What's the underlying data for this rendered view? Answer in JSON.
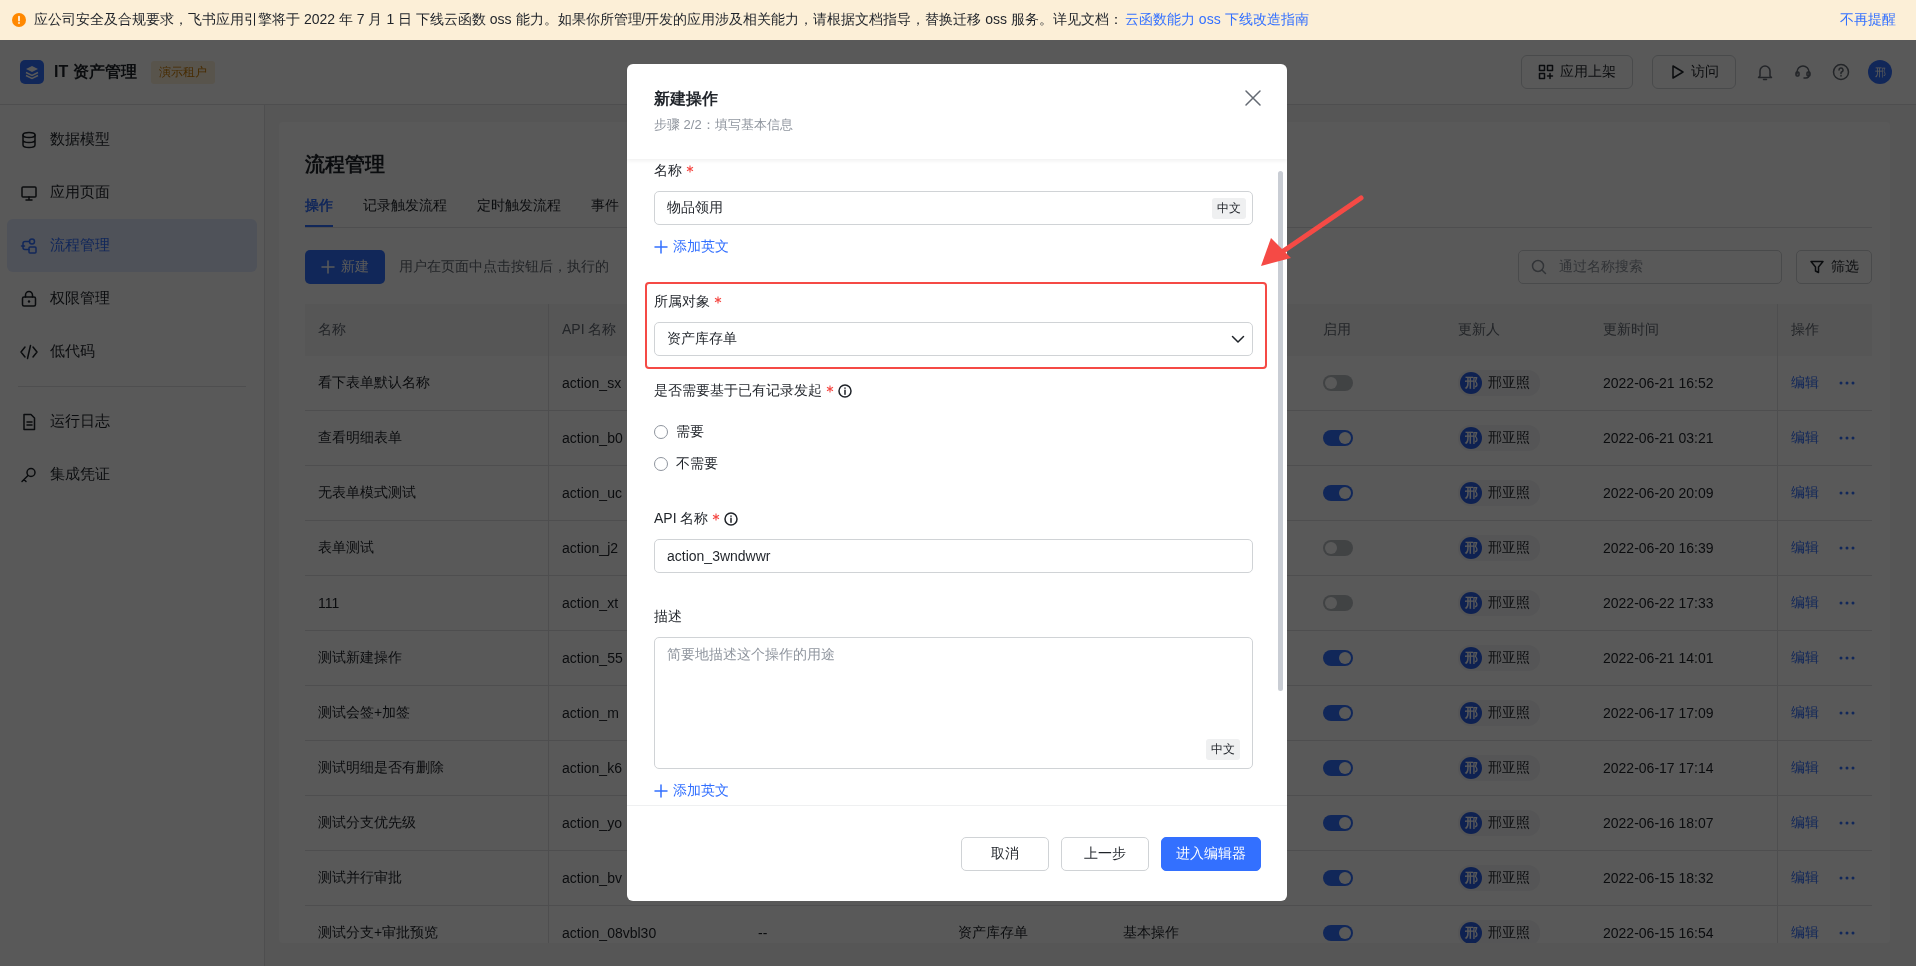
{
  "notice_bar": {
    "text": "应公司安全及合规要求，飞书应用引擎将于 2022 年 7 月 1 日 下线云函数 oss 能力。如果你所管理/开发的应用涉及相关能力，请根据文档指导，替换迁移 oss 服务。详见文档：",
    "link": "云函数能力 oss 下线改造指南",
    "dismiss": "不再提醒"
  },
  "header": {
    "app_name": "IT 资产管理",
    "tenant_tag": "演示租户",
    "buttons": [
      {
        "label": "应用上架",
        "kind": "grid"
      },
      {
        "label": "访问",
        "kind": "play"
      }
    ],
    "avatar": "邢"
  },
  "sidebar": {
    "groups": [
      {
        "items": [
          {
            "label": "数据模型",
            "kind": "database",
            "selected": false
          },
          {
            "label": "应用页面",
            "kind": "monitor",
            "selected": false
          },
          {
            "label": "流程管理",
            "kind": "flow",
            "selected": true
          },
          {
            "label": "权限管理",
            "kind": "lock",
            "selected": false
          },
          {
            "label": "低代码",
            "kind": "code",
            "selected": false
          }
        ]
      },
      {
        "items": [
          {
            "label": "运行日志",
            "kind": "document",
            "selected": false
          },
          {
            "label": "集成凭证",
            "kind": "key",
            "selected": false
          }
        ]
      }
    ]
  },
  "page": {
    "title": "流程管理",
    "tabs": [
      {
        "label": "操作",
        "selected": true
      },
      {
        "label": "记录触发流程",
        "selected": false
      },
      {
        "label": "定时触发流程",
        "selected": false
      },
      {
        "label": "事件",
        "selected": false
      }
    ],
    "new_button": "新建",
    "description": "用户在页面中点击按钮后，执行的",
    "search": {
      "placeholder": "通过名称搜索"
    },
    "filter_button": "筛选"
  },
  "table": {
    "header": {
      "name": "名称",
      "api_name": "API 名称",
      "enabled": "启用",
      "updater": "更新人",
      "updated_at": "更新时间",
      "actions": "操作"
    },
    "rows": [
      {
        "name": "看下表单默认名称",
        "api_name": "action_sx",
        "enabled": false,
        "updater": {
          "avatar": "邢",
          "name": "邢亚照"
        },
        "updated_at": "2022-06-21 16:52",
        "action": "编辑"
      },
      {
        "name": "查看明细表单",
        "api_name": "action_b0",
        "enabled": true,
        "updater": {
          "avatar": "邢",
          "name": "邢亚照"
        },
        "updated_at": "2022-06-21 03:21",
        "action": "编辑"
      },
      {
        "name": "无表单模式测试",
        "api_name": "action_uc",
        "enabled": true,
        "updater": {
          "avatar": "邢",
          "name": "邢亚照"
        },
        "updated_at": "2022-06-20 20:09",
        "action": "编辑"
      },
      {
        "name": "表单测试",
        "api_name": "action_j2",
        "enabled": false,
        "updater": {
          "avatar": "邢",
          "name": "邢亚照"
        },
        "updated_at": "2022-06-20 16:39",
        "action": "编辑"
      },
      {
        "name": "111",
        "api_name": "action_xt",
        "enabled": false,
        "updater": {
          "avatar": "邢",
          "name": "邢亚照"
        },
        "updated_at": "2022-06-22 17:33",
        "action": "编辑"
      },
      {
        "name": "测试新建操作",
        "api_name": "action_55",
        "enabled": true,
        "updater": {
          "avatar": "邢",
          "name": "邢亚照"
        },
        "updated_at": "2022-06-21 14:01",
        "action": "编辑"
      },
      {
        "name": "测试会签+加签",
        "api_name": "action_m",
        "enabled": true,
        "updater": {
          "avatar": "邢",
          "name": "邢亚照"
        },
        "updated_at": "2022-06-17 17:09",
        "action": "编辑"
      },
      {
        "name": "测试明细是否有删除",
        "api_name": "action_k6",
        "enabled": true,
        "updater": {
          "avatar": "邢",
          "name": "邢亚照"
        },
        "updated_at": "2022-06-17 17:14",
        "action": "编辑"
      },
      {
        "name": "测试分支优先级",
        "api_name": "action_yo",
        "enabled": true,
        "updater": {
          "avatar": "邢",
          "name": "邢亚照"
        },
        "updated_at": "2022-06-16 18:07",
        "action": "编辑"
      },
      {
        "name": "测试并行审批",
        "api_name": "action_bv",
        "enabled": true,
        "updater": {
          "avatar": "邢",
          "name": "邢亚照"
        },
        "updated_at": "2022-06-15 18:32",
        "action": "编辑"
      },
      {
        "name": "测试分支+审批预览",
        "api_name": "action_08vbl30",
        "column_3": "--",
        "column_4": "资产库存单",
        "column_5": "基本操作",
        "enabled": true,
        "updater": {
          "avatar": "邢",
          "name": "邢亚照"
        },
        "updated_at": "2022-06-15 16:54",
        "action": "编辑"
      }
    ]
  },
  "modal": {
    "title": "新建操作",
    "subtitle": "步骤 2/2：填写基本信息",
    "fields": [
      {
        "kind": "text",
        "label": "名称",
        "required": true,
        "value": "物品领用",
        "lang_tag": "中文",
        "add_link": "添加英文"
      },
      {
        "kind": "select",
        "label": "所属对象",
        "required": true,
        "value": "资产库存单",
        "highlighted": true
      },
      {
        "kind": "radio",
        "label": "是否需要基于已有记录发起",
        "required": true,
        "info": true,
        "options": [
          {
            "label": "需要",
            "selected": false
          },
          {
            "label": "不需要",
            "selected": false
          }
        ]
      },
      {
        "kind": "text",
        "label": "API 名称",
        "required": true,
        "info": true,
        "value": "action_3wndwwr"
      },
      {
        "kind": "textarea",
        "label": "描述",
        "required": false,
        "placeholder": "简要地描述这个操作的用途",
        "lang_tag": "中文",
        "add_link": "添加英文"
      }
    ],
    "buttons": [
      {
        "label": "取消",
        "kind": "default"
      },
      {
        "label": "上一步",
        "kind": "default"
      },
      {
        "label": "进入编辑器",
        "kind": "primary"
      }
    ]
  }
}
